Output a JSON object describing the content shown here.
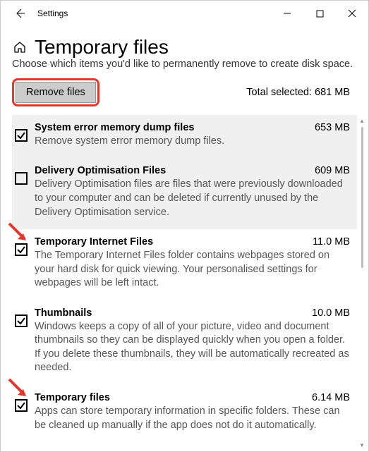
{
  "window": {
    "title": "Settings"
  },
  "page": {
    "heading": "Temporary files",
    "intro": "Choose which items you'd like to permanently remove to create disk space.",
    "remove_button": "Remove files",
    "total_label": "Total selected: 681 MB"
  },
  "items": [
    {
      "title": "System error memory dump files",
      "size": "653 MB",
      "desc": "Remove system error memory dump files.",
      "checked": true,
      "highlight": true,
      "arrow": false
    },
    {
      "title": "Delivery Optimisation Files",
      "size": "609 MB",
      "desc": "Delivery Optimisation files are files that were previously downloaded to your computer and can be deleted if currently unused by the Delivery Optimisation service.",
      "checked": false,
      "highlight": true,
      "arrow": false
    },
    {
      "title": "Temporary Internet Files",
      "size": "11.0 MB",
      "desc": "The Temporary Internet Files folder contains webpages stored on your hard disk for quick viewing. Your personalised settings for webpages will be left intact.",
      "checked": true,
      "highlight": false,
      "arrow": true
    },
    {
      "title": "Thumbnails",
      "size": "10.0 MB",
      "desc": "Windows keeps a copy of all of your picture, video and document thumbnails so they can be displayed quickly when you open a folder. If you delete these thumbnails, they will be automatically recreated as needed.",
      "checked": true,
      "highlight": false,
      "arrow": false
    },
    {
      "title": "Temporary files",
      "size": "6.14 MB",
      "desc": "Apps can store temporary information in specific folders. These can be cleaned up manually if the app does not do it automatically.",
      "checked": true,
      "highlight": false,
      "arrow": true
    }
  ]
}
